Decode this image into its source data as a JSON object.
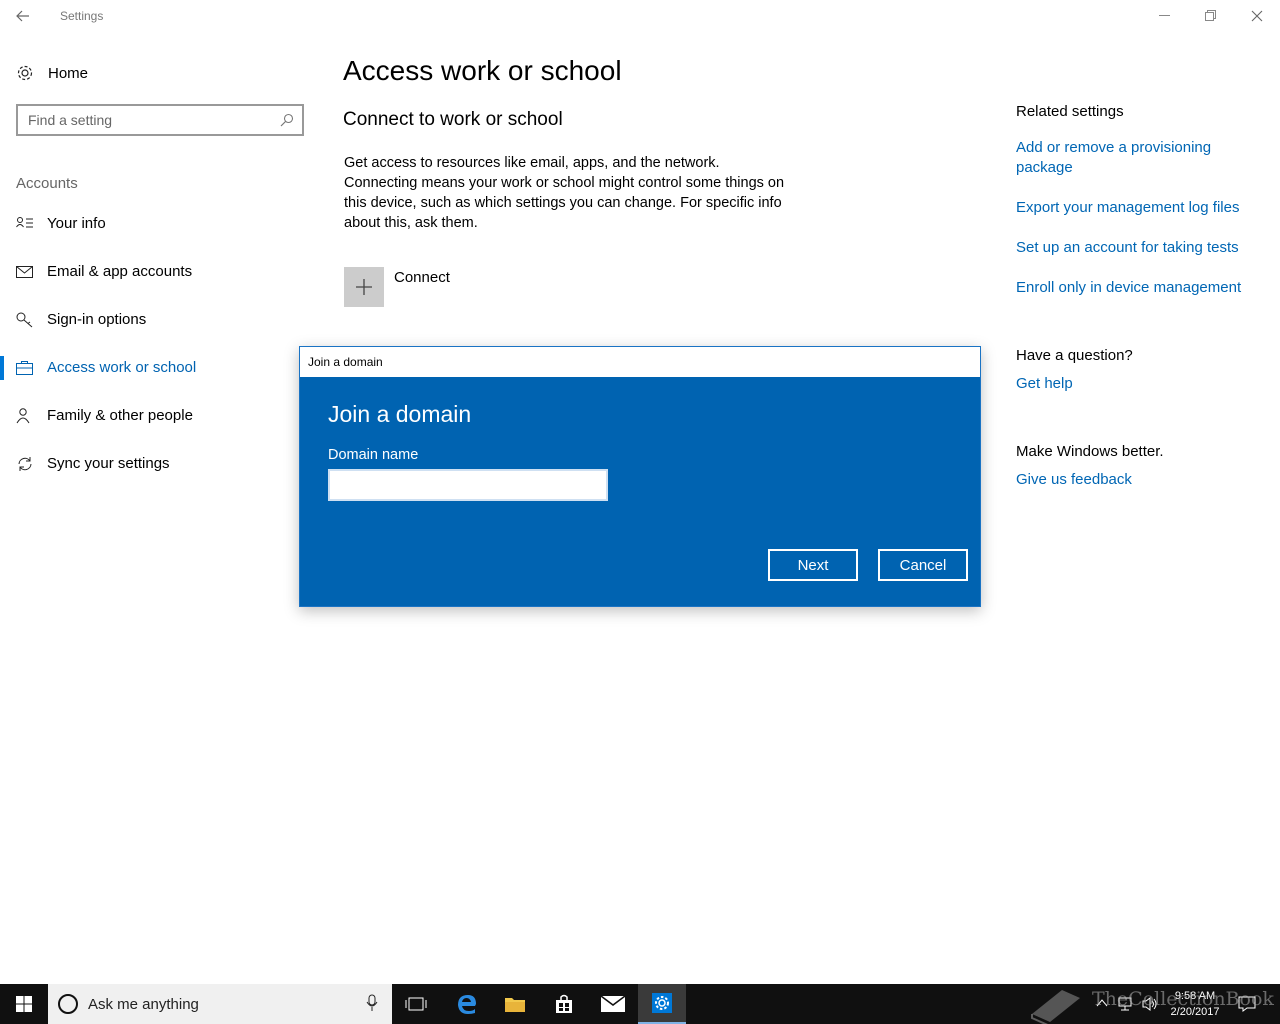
{
  "window": {
    "title": "Settings",
    "controls": {
      "minimize": "minimize",
      "restore": "restore",
      "close": "close"
    }
  },
  "nav": {
    "home_label": "Home",
    "search_placeholder": "Find a setting",
    "section_label": "Accounts",
    "items": [
      {
        "label": "Your info",
        "icon": "person-card-icon",
        "selected": false
      },
      {
        "label": "Email & app accounts",
        "icon": "mail-icon",
        "selected": false
      },
      {
        "label": "Sign-in options",
        "icon": "key-icon",
        "selected": false
      },
      {
        "label": "Access work or school",
        "icon": "briefcase-icon",
        "selected": true
      },
      {
        "label": "Family & other people",
        "icon": "person-add-icon",
        "selected": false
      },
      {
        "label": "Sync your settings",
        "icon": "sync-icon",
        "selected": false
      }
    ]
  },
  "main": {
    "title": "Access work or school",
    "subtitle": "Connect to work or school",
    "description": "Get access to resources like email, apps, and the network. Connecting means your work or school might control some things on this device, such as which settings you can change. For specific info about this, ask them.",
    "connect_label": "Connect"
  },
  "related": {
    "heading": "Related settings",
    "links": [
      "Add or remove a provisioning package",
      "Export your management log files",
      "Set up an account for taking tests",
      "Enroll only in device management"
    ],
    "question_heading": "Have a question?",
    "help_link": "Get help",
    "better_heading": "Make Windows better.",
    "feedback_link": "Give us feedback"
  },
  "dialog": {
    "window_title": "Join a domain",
    "heading": "Join a domain",
    "field_label": "Domain name",
    "field_value": "",
    "next_label": "Next",
    "cancel_label": "Cancel"
  },
  "taskbar": {
    "search_placeholder": "Ask me anything",
    "time": "9:58 AM",
    "date": "2/20/2017",
    "watermark": "TheCollectionBook"
  },
  "colors": {
    "accent": "#0078d7",
    "dialog_bg": "#0063b1",
    "link": "#0066b4"
  }
}
